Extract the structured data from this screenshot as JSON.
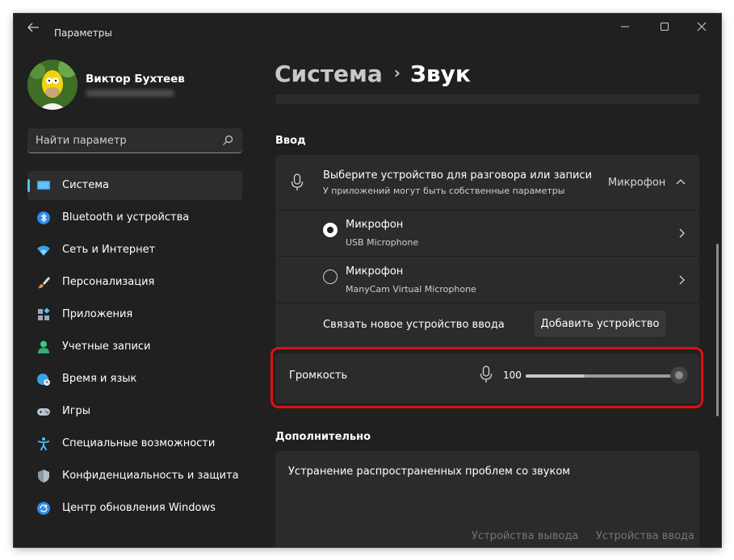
{
  "window": {
    "app_title": "Параметры"
  },
  "profile": {
    "name": "Виктор Бухтеев"
  },
  "search": {
    "placeholder": "Найти параметр"
  },
  "nav": {
    "items": [
      {
        "label": "Система",
        "icon": "system-icon",
        "active": true
      },
      {
        "label": "Bluetooth и устройства",
        "icon": "bluetooth-icon"
      },
      {
        "label": "Сеть и Интернет",
        "icon": "wifi-icon"
      },
      {
        "label": "Персонализация",
        "icon": "brush-icon"
      },
      {
        "label": "Приложения",
        "icon": "apps-icon"
      },
      {
        "label": "Учетные записи",
        "icon": "user-icon"
      },
      {
        "label": "Время и язык",
        "icon": "globe-clock-icon"
      },
      {
        "label": "Игры",
        "icon": "gamepad-icon"
      },
      {
        "label": "Специальные возможности",
        "icon": "accessibility-icon"
      },
      {
        "label": "Конфиденциальность и защита",
        "icon": "shield-icon"
      },
      {
        "label": "Центр обновления Windows",
        "icon": "update-icon"
      }
    ]
  },
  "breadcrumb": {
    "parent": "Система",
    "separator": "›",
    "current": "Звук"
  },
  "input_section": {
    "label": "Ввод",
    "chooser": {
      "title": "Выберите устройство для разговора или записи",
      "subtitle": "У приложений могут быть собственные параметры",
      "selected": "Микрофон"
    },
    "devices": [
      {
        "name": "Микрофон",
        "detail": "USB Microphone",
        "selected": true
      },
      {
        "name": "Микрофон",
        "detail": "ManyCam Virtual Microphone",
        "selected": false
      }
    ],
    "pair": {
      "label": "Связать новое устройство ввода",
      "button": "Добавить устройство"
    },
    "volume": {
      "label": "Громкость",
      "value": "100",
      "fill_fraction": 0.38
    }
  },
  "advanced": {
    "label": "Дополнительно",
    "troubleshoot_title": "Устранение распространенных проблем со звуком",
    "links": [
      "Устройства вывода",
      "Устройства ввода"
    ]
  },
  "colors": {
    "accent": "#4cc2ff",
    "highlight": "#e01010",
    "background": "#202020",
    "card": "#2b2b2b"
  }
}
